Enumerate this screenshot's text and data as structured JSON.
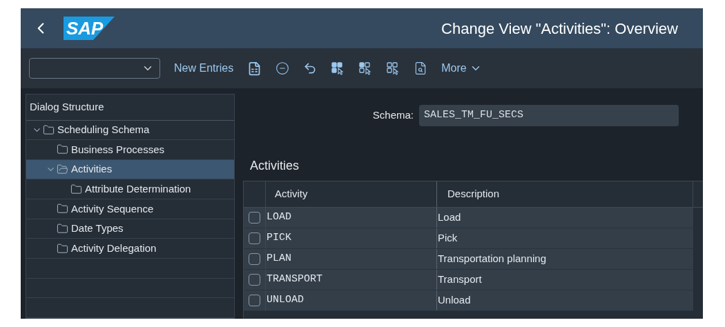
{
  "header": {
    "logo": "SAP",
    "title": "Change View \"Activities\": Overview"
  },
  "toolbar": {
    "new_entries": "New Entries",
    "more": "More"
  },
  "dialog_structure": {
    "title": "Dialog Structure",
    "items": [
      {
        "label": "Scheduling Schema",
        "expanded": true,
        "selected": false,
        "children": [
          {
            "label": "Business Processes",
            "selected": false
          },
          {
            "label": "Activities",
            "expanded": true,
            "selected": true,
            "children": [
              {
                "label": "Attribute Determination",
                "selected": false
              }
            ]
          },
          {
            "label": "Activity Sequence",
            "selected": false
          },
          {
            "label": "Date Types",
            "selected": false
          },
          {
            "label": "Activity Delegation",
            "selected": false
          }
        ]
      }
    ]
  },
  "schema": {
    "label": "Schema:",
    "value": "SALES_TM_FU_SECS"
  },
  "table": {
    "title": "Activities",
    "columns": [
      "Activity",
      "Description"
    ],
    "rows": [
      {
        "activity": "LOAD",
        "description": "Load",
        "checked": false
      },
      {
        "activity": "PICK",
        "description": "Pick",
        "checked": false
      },
      {
        "activity": "PLAN",
        "description": "Transportation planning",
        "checked": false
      },
      {
        "activity": "TRANSPORT",
        "description": "Transport",
        "checked": false
      },
      {
        "activity": "UNLOAD",
        "description": "Unload",
        "checked": false
      }
    ]
  }
}
